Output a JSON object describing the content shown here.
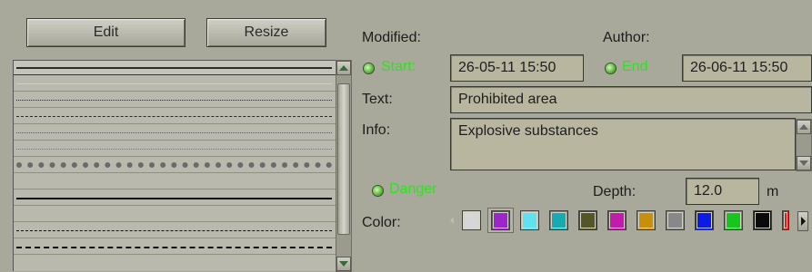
{
  "toolbar": {
    "edit_label": "Edit",
    "resize_label": "Resize"
  },
  "line_styles": [
    {
      "style": "solid-thick",
      "selected": true
    },
    {
      "style": "solid-thin"
    },
    {
      "style": "dotted"
    },
    {
      "style": "dash-dot"
    },
    {
      "style": "dense-dot"
    },
    {
      "style": "fine-dot"
    },
    {
      "style": "hatched-bar"
    },
    {
      "style": "none"
    },
    {
      "style": "solid-bold"
    },
    {
      "style": "none"
    },
    {
      "style": "long-dash"
    },
    {
      "style": "dashed-bold"
    }
  ],
  "form": {
    "modified_label": "Modified:",
    "author_label": "Author:",
    "start_label": "Start:",
    "start_value": "26-05-11 15:50",
    "end_label": "End",
    "end_value": "26-06-11 15:50",
    "text_label": "Text:",
    "text_value": "Prohibited area",
    "info_label": "Info:",
    "info_value": "Explosive substances",
    "danger_label": "Danger",
    "depth_label": "Depth:",
    "depth_value": "12.0",
    "depth_unit": "m",
    "color_label": "Color:"
  },
  "colors": {
    "background": "#a9a99b",
    "indicator_green": "#2de31f",
    "field_bg": "#b9b6a0",
    "palette": [
      "#d6d6d6",
      "#9a27c9",
      "#5fe1ef",
      "#18a9b3",
      "#55552a",
      "#c21aa9",
      "#c88f0b",
      "#888888",
      "#0b1be3",
      "#17c51c",
      "#0a0a0a",
      "#e01a1a"
    ],
    "selected_palette_index": 1
  }
}
